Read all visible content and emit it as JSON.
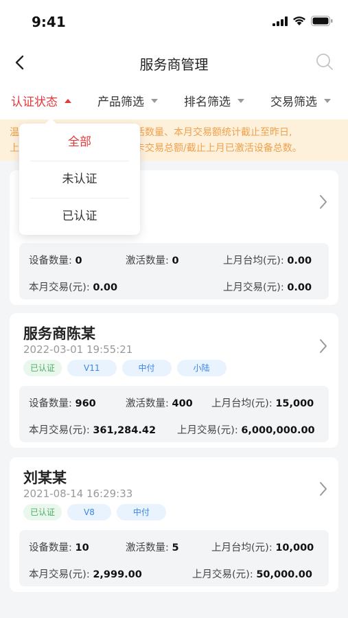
{
  "status": {
    "time": "9:41"
  },
  "nav": {
    "title": "服务商管理",
    "back_icon": "chevron-left-icon",
    "search_icon": "search-icon"
  },
  "filters": {
    "items": [
      {
        "label": "认证状态",
        "active": true
      },
      {
        "label": "产品筛选",
        "active": false
      },
      {
        "label": "排名筛选",
        "active": false
      },
      {
        "label": "交易筛选",
        "active": false
      }
    ]
  },
  "notice": {
    "line1_start": "温",
    "line1_end": "活数量、本月交易额统计截止至昨日,",
    "line2_start": "上",
    "line2_end": "卡交易总额/截止上月已激活设备总数。"
  },
  "dropdown": {
    "options": [
      "全部",
      "未认证",
      "已认证"
    ],
    "selected": "全部"
  },
  "colors": {
    "accent": "#e5383b",
    "tag_blue": "#3b84e6",
    "tag_green": "#4cae63",
    "notice": "#f0a04a"
  },
  "labels": {
    "devices": "设备数量:",
    "activated": "激活数量:",
    "last_avg": "上月台均(元):",
    "this_month": "本月交易(元):",
    "last_month": "上月交易(元):"
  },
  "cards": [
    {
      "stats": {
        "devices": "0",
        "activated": "0",
        "last_avg": "0.00",
        "this_month": "0.00",
        "last_month": "0.00"
      }
    },
    {
      "name": "服务商陈某",
      "date": "2022-03-01 19:55:21",
      "tags": [
        "已认证",
        "V11",
        "中付",
        "小陆"
      ],
      "stats": {
        "devices": "960",
        "activated": "400",
        "last_avg": "15,000",
        "this_month": "361,284.42",
        "last_month": "6,000,000.00"
      }
    },
    {
      "name": "刘某某",
      "date": "2021-08-14 16:29:33",
      "tags": [
        "已认证",
        "V8",
        "中付"
      ],
      "stats": {
        "devices": "10",
        "activated": "5",
        "last_avg": "10,000",
        "this_month": "2,999.00",
        "last_month": "50,000.00"
      }
    }
  ]
}
